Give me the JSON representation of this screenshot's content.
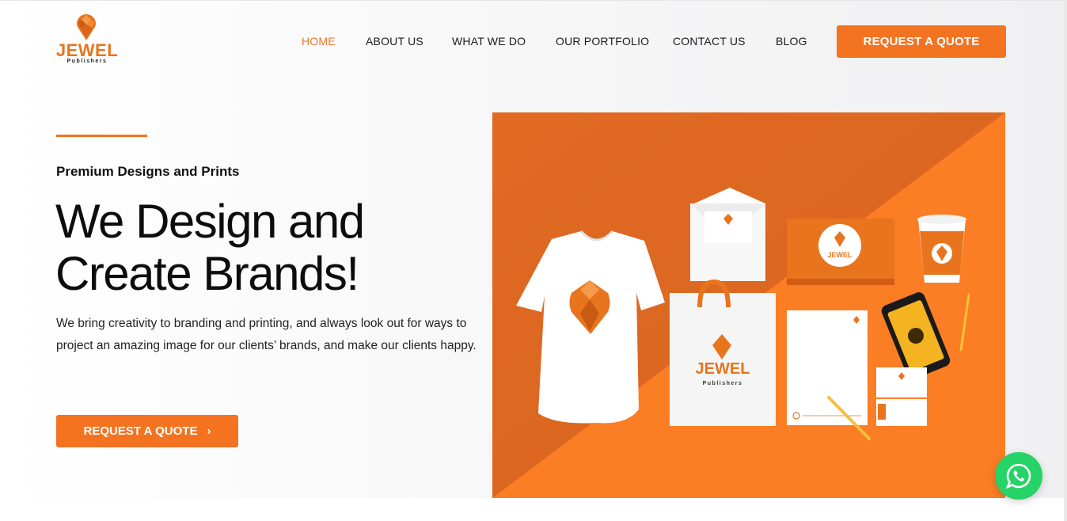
{
  "brand": {
    "name": "JEWEL",
    "tagline": "Publishers",
    "accent": "#f47320"
  },
  "nav": {
    "items": [
      {
        "label": "HOME",
        "active": true
      },
      {
        "label": "ABOUT US",
        "active": false
      },
      {
        "label": "WHAT WE DO",
        "active": false
      },
      {
        "label": "OUR PORTFOLIO",
        "active": false
      },
      {
        "label": "CONTACT US",
        "active": false
      },
      {
        "label": "BLOG",
        "active": false
      }
    ],
    "cta_label": "REQUEST A QUOTE"
  },
  "hero": {
    "eyebrow": "Premium Designs and Prints",
    "headline_line1": "We Design and",
    "headline_line2": "Create Brands!",
    "body": "We bring creativity to branding and printing, and always look out for ways to project an amazing image for our clients’ brands, and make our clients happy.",
    "cta_label": "REQUEST A QUOTE",
    "cta_icon": "chevron-right-icon",
    "image": {
      "mockup_brand": "JEWEL",
      "mockup_tagline": "Publishers"
    }
  },
  "whatsapp": {
    "icon": "whatsapp-icon",
    "color": "#25d366"
  }
}
